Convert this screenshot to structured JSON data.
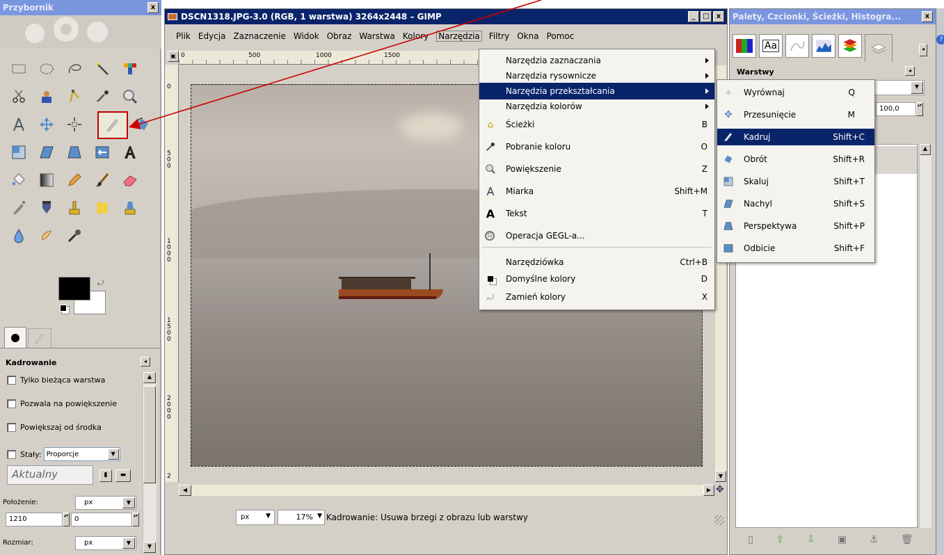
{
  "toolbox": {
    "title": "Przybornik",
    "close_label": "x",
    "options_title": "Kadrowanie",
    "options": [
      {
        "label": "Tylko bieżąca warstwa"
      },
      {
        "label": "Pozwala na powiększenie"
      },
      {
        "label": "Powiększaj od środka"
      }
    ],
    "fixed_label": "Stały:",
    "fixed_select": "Proporcje",
    "current_value": "Aktualny",
    "position_label": "Położenie:",
    "position_unit": "px",
    "position_x": "1210",
    "position_y": "0",
    "size_label": "Rozmiar:",
    "size_unit": "px"
  },
  "image_window": {
    "title": "DSCN1318.JPG-3.0 (RGB, 1 warstwa) 3264x2448 – GIMP",
    "menubar": [
      "Plik",
      "Edycja",
      "Zaznaczenie",
      "Widok",
      "Obraz",
      "Warstwa",
      "Kolory",
      "Narzędzia",
      "Filtry",
      "Okna",
      "Pomoc"
    ],
    "ruler_h": [
      "0",
      "500",
      "1000",
      "1500"
    ],
    "ruler_v": [
      "0",
      "5 0 0",
      "1 0 0 0",
      "1 5 0 0",
      "2 0 0 0",
      "2"
    ],
    "unit": "px",
    "zoom": "17%",
    "status": "Kadrowanie: Usuwa brzegi z obrazu lub warstwy"
  },
  "tools_menu": {
    "items": [
      {
        "label": "Narzędzia zaznaczania",
        "shortcut": "",
        "submenu": true
      },
      {
        "label": "Narzędzia rysownicze",
        "shortcut": "",
        "submenu": true
      },
      {
        "label": "Narzędzia przekształcania",
        "shortcut": "",
        "submenu": true,
        "highlighted": true
      },
      {
        "label": "Narzędzia kolorów",
        "shortcut": "",
        "submenu": true
      },
      {
        "label": "Ścieżki",
        "shortcut": "B",
        "icon": "paths-icon"
      },
      {
        "label": "Pobranie koloru",
        "shortcut": "O",
        "icon": "color-picker-icon"
      },
      {
        "label": "Powiększenie",
        "shortcut": "Z",
        "icon": "zoom-icon"
      },
      {
        "label": "Miarka",
        "shortcut": "Shift+M",
        "icon": "measure-icon"
      },
      {
        "label": "Tekst",
        "shortcut": "T",
        "icon": "text-icon"
      },
      {
        "label": "Operacja GEGL-a...",
        "shortcut": "",
        "icon": "gegl-icon"
      },
      {
        "label": "Narzędziówka",
        "shortcut": "Ctrl+B"
      },
      {
        "label": "Domyślne kolory",
        "shortcut": "D",
        "icon": "default-colors-icon"
      },
      {
        "label": "Zamień kolory",
        "shortcut": "X",
        "icon": "swap-colors-icon"
      }
    ]
  },
  "transform_menu": {
    "items": [
      {
        "label": "Wyrównaj",
        "shortcut": "Q",
        "icon": "align-icon"
      },
      {
        "label": "Przesunięcie",
        "shortcut": "M",
        "icon": "move-icon"
      },
      {
        "label": "Kadruj",
        "shortcut": "Shift+C",
        "icon": "crop-icon",
        "highlighted": true
      },
      {
        "label": "Obrót",
        "shortcut": "Shift+R",
        "icon": "rotate-icon"
      },
      {
        "label": "Skaluj",
        "shortcut": "Shift+T",
        "icon": "scale-icon"
      },
      {
        "label": "Nachyl",
        "shortcut": "Shift+S",
        "icon": "shear-icon"
      },
      {
        "label": "Perspektywa",
        "shortcut": "Shift+P",
        "icon": "perspective-icon"
      },
      {
        "label": "Odbicie",
        "shortcut": "Shift+F",
        "icon": "flip-icon"
      }
    ]
  },
  "docks": {
    "title": "Palety, Czcionki, Ścieżki, Histogra...",
    "layers_title": "Warstwy",
    "opacity": "100,0",
    "tab_icons": [
      "palette-icon",
      "font-icon",
      "paths-icon",
      "histogram-icon",
      "layers-icon",
      "stack-icon"
    ]
  },
  "annotation_color": "#cc0000",
  "highlight_color": "#0a246a"
}
